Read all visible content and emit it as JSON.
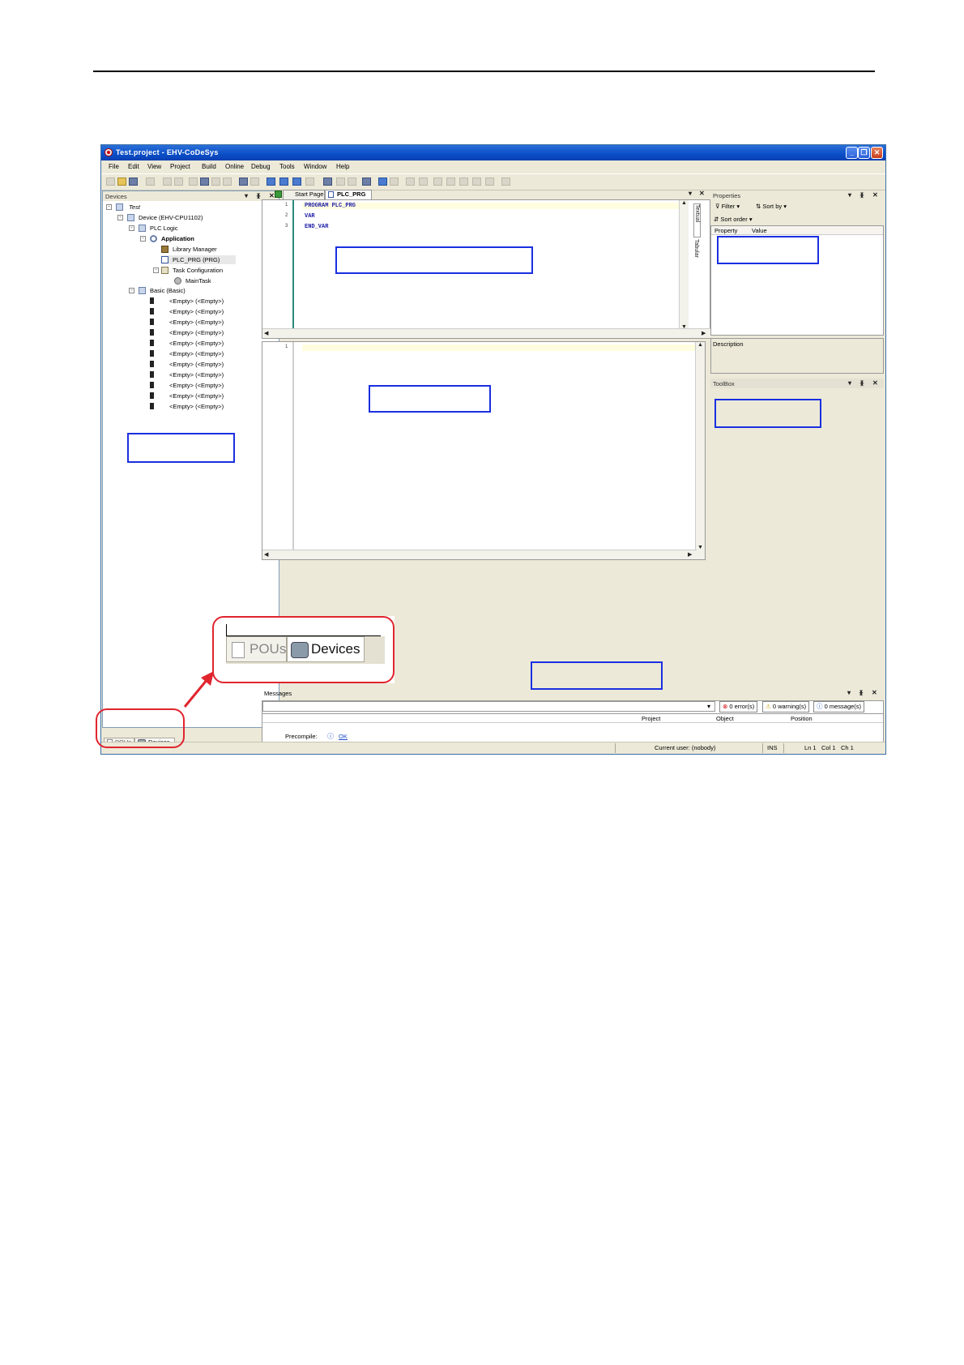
{
  "window": {
    "title": "Test.project - EHV-CoDeSys",
    "buttons": [
      "_",
      "❐",
      "✕"
    ]
  },
  "menu": [
    "File",
    "Edit",
    "View",
    "Project",
    "Build",
    "Online",
    "Debug",
    "Tools",
    "Window",
    "Help"
  ],
  "devices_panel": {
    "title": "Devices",
    "tree": [
      {
        "label": "Test",
        "icon": "project-icon"
      },
      {
        "label": "Device (EHV-CPU1102)",
        "icon": "device-icon"
      },
      {
        "label": "PLC Logic",
        "icon": "plc-logic-icon"
      },
      {
        "label": "Application",
        "icon": "application-icon"
      },
      {
        "label": "Library Manager",
        "icon": "library-icon"
      },
      {
        "label": "PLC_PRG (PRG)",
        "icon": "program-icon"
      },
      {
        "label": "Task Configuration",
        "icon": "task-config-icon"
      },
      {
        "label": "MainTask",
        "icon": "task-gear-icon"
      },
      {
        "label": "Basic (Basic)",
        "icon": "basic-icon"
      }
    ],
    "slots": [
      "<Empty> (<Empty>)",
      "<Empty> (<Empty>)",
      "<Empty> (<Empty>)",
      "<Empty> (<Empty>)",
      "<Empty> (<Empty>)",
      "<Empty> (<Empty>)",
      "<Empty> (<Empty>)",
      "<Empty> (<Empty>)",
      "<Empty> (<Empty>)",
      "<Empty> (<Empty>)",
      "<Empty> (<Empty>)"
    ],
    "bottom_tabs": [
      "POUs",
      "Devices"
    ]
  },
  "editor": {
    "tabs": [
      "Start Page",
      "PLC_PRG"
    ],
    "decl_lines": [
      {
        "n": "1",
        "text": "PROGRAM PLC_PRG"
      },
      {
        "n": "2",
        "text": "VAR"
      },
      {
        "n": "3",
        "text": "END_VAR"
      }
    ],
    "body_lines": [
      {
        "n": "1",
        "text": ""
      }
    ],
    "side_tabs": [
      "Textual",
      "Tabular"
    ]
  },
  "properties": {
    "title": "Properties",
    "filter": "Filter",
    "sort_by": "Sort by",
    "sort_order": "Sort order",
    "columns": [
      "Property",
      "Value"
    ],
    "description": "Description"
  },
  "toolbox": {
    "title": "ToolBox"
  },
  "messages": {
    "title": "Messages",
    "errors": "0 error(s)",
    "warnings": "0 warning(s)",
    "messages": "0 message(s)",
    "columns": [
      "Project",
      "Object",
      "Position"
    ]
  },
  "status": {
    "precompile_label": "Precompile:",
    "precompile_value": "OK",
    "user": "Current user: (nobody)",
    "ins": "INS",
    "ln": "Ln 1",
    "col": "Col 1",
    "ch": "Ch 1"
  },
  "callout": {
    "tabs": [
      "POUs",
      "Devices"
    ]
  },
  "colors": {
    "annotation_box": "#1a2fe0",
    "highlight": "#e0252f",
    "title_bar": "#0a4ec7"
  }
}
